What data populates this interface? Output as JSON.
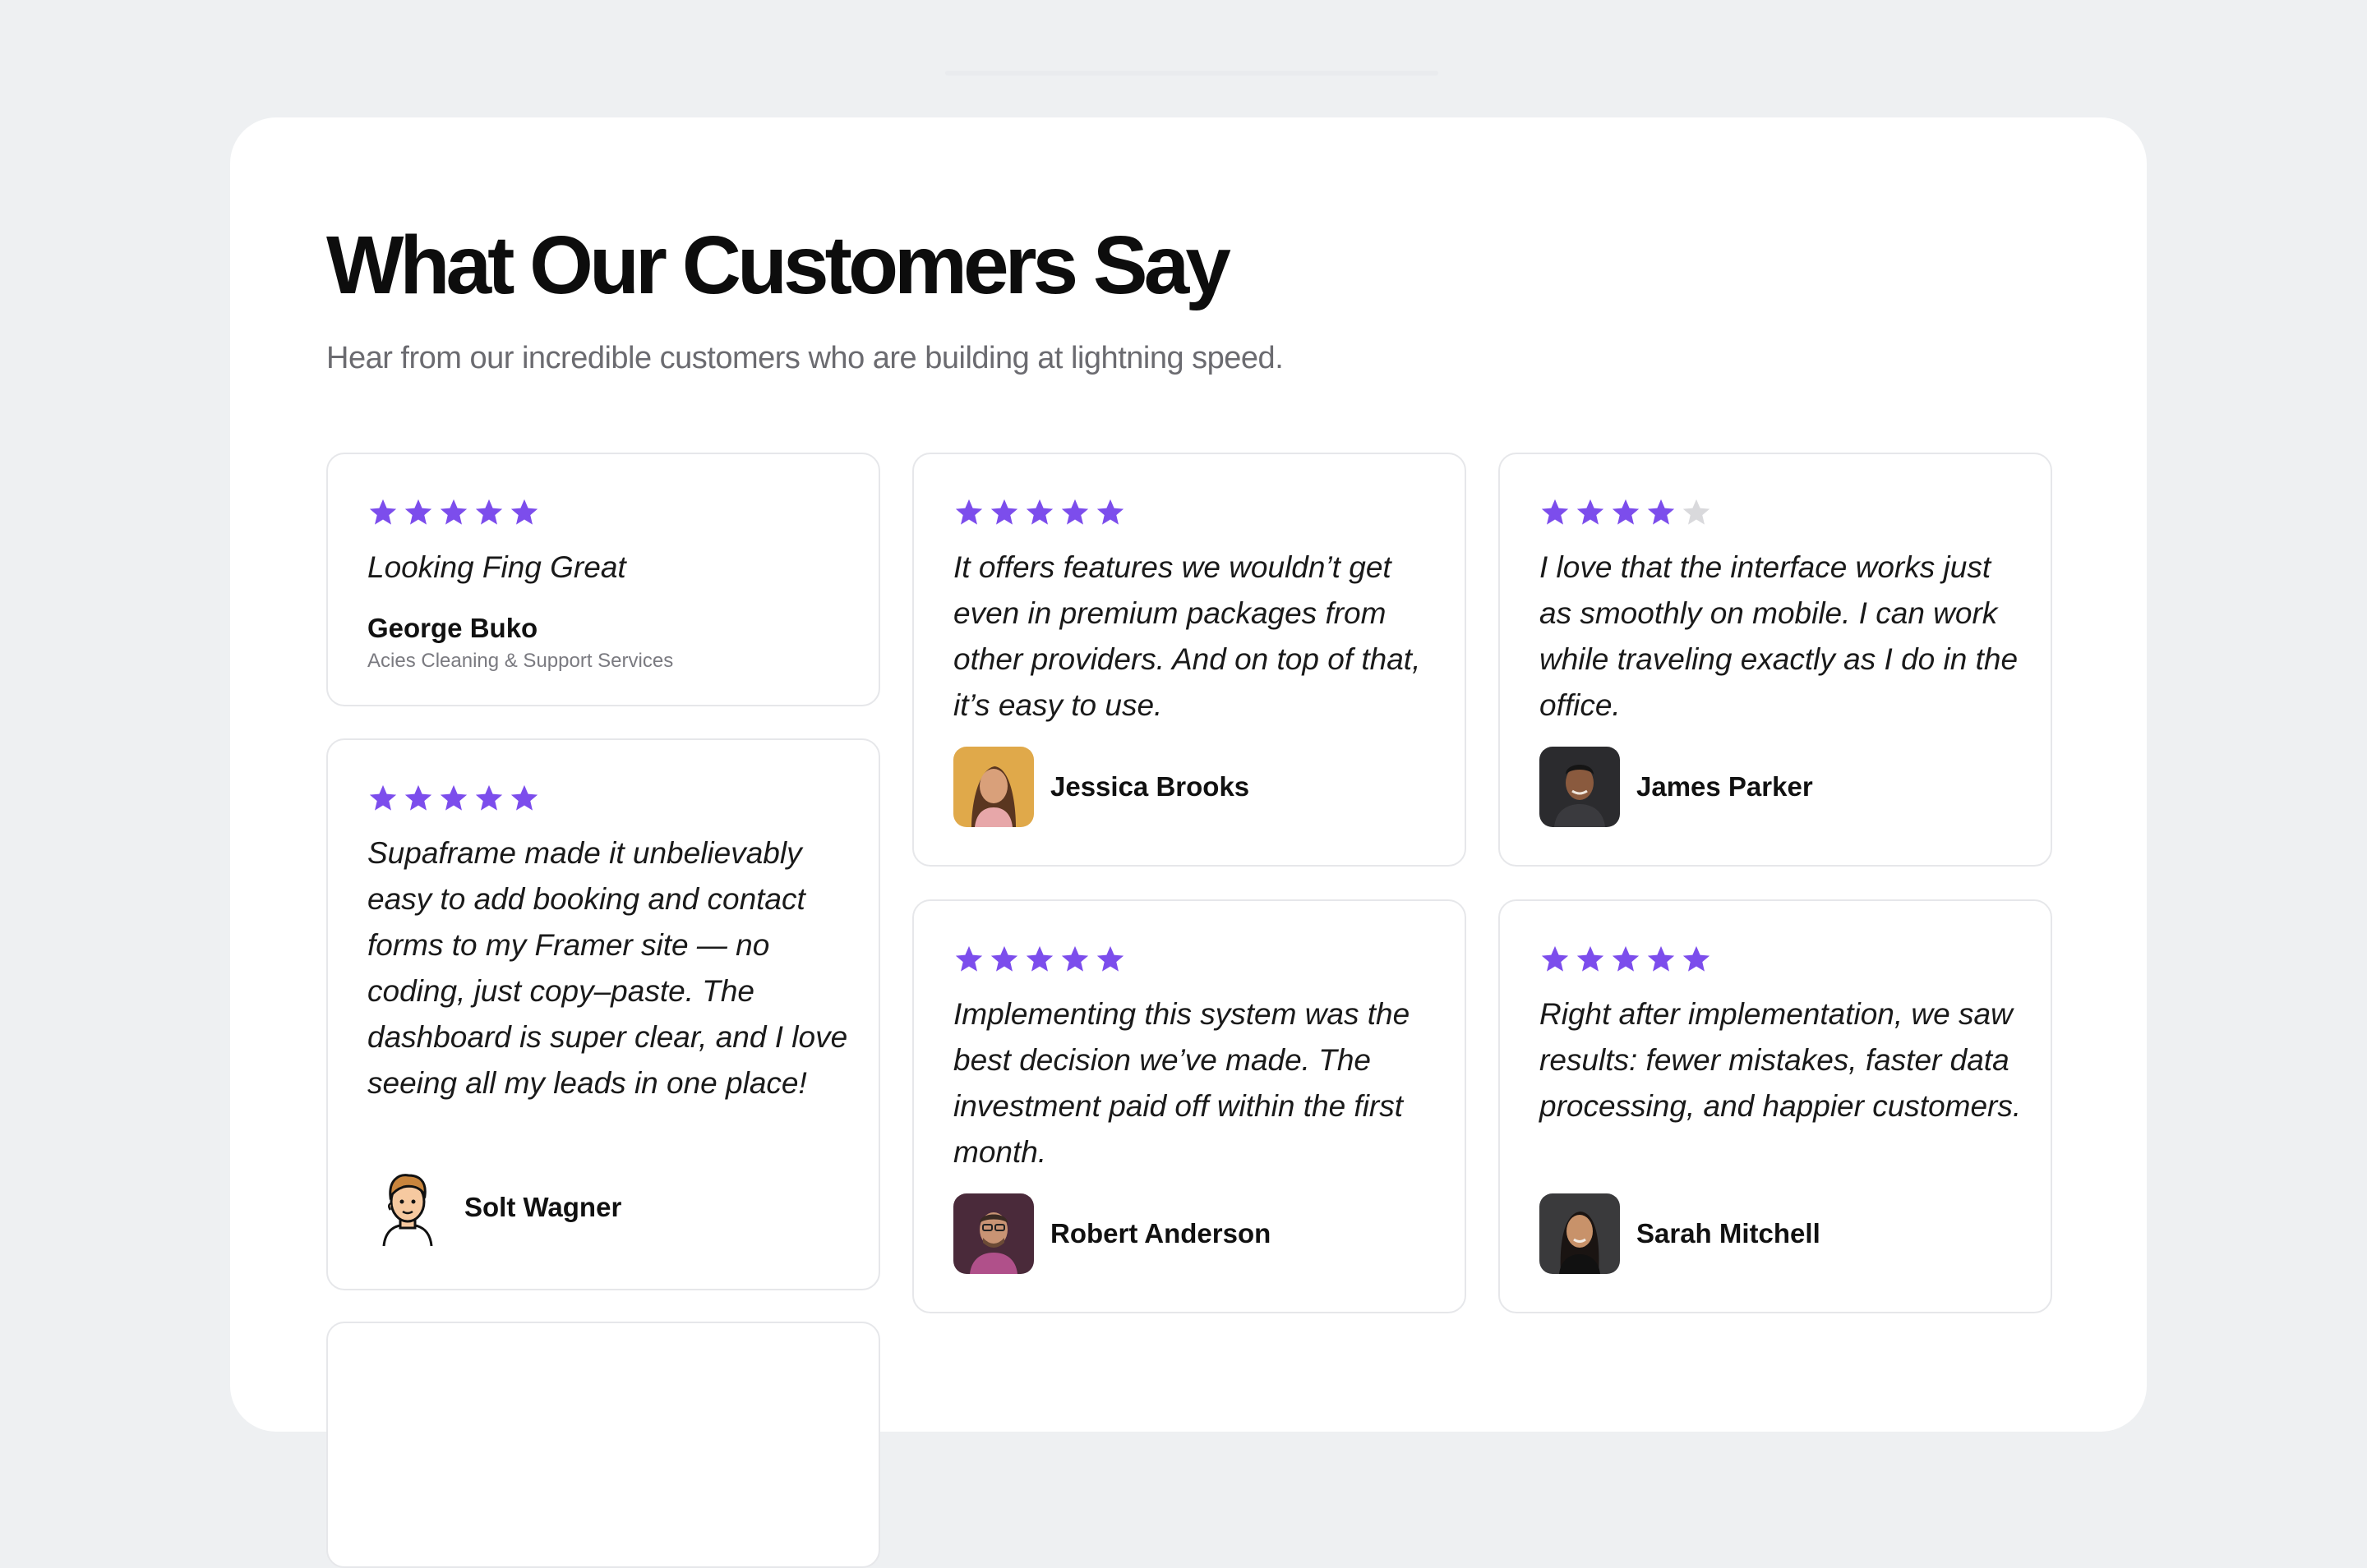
{
  "section": {
    "title": "What Our Customers Say",
    "subtitle": "Hear from our incredible customers who are building at lightning speed."
  },
  "colors": {
    "star_filled": "#7c4dec",
    "star_empty": "#d9d9dc"
  },
  "testimonials": [
    {
      "rating": 5,
      "quote": "Looking Fing Great",
      "name": "George Buko",
      "company": "Acies Cleaning & Support Services"
    },
    {
      "rating": 5,
      "quote": "Supaframe made it unbelievably easy to add booking and contact forms to my Framer site — no coding, just copy–paste. The dashboard is super clear, and I love seeing all my leads in one place!",
      "name": "Solt Wagner",
      "avatar": "cartoon-avatar"
    },
    {
      "rating": 5,
      "quote": "It offers features we wouldn’t get even in premium packages from other providers. And on top of that, it’s easy to use.",
      "name": "Jessica Brooks",
      "avatar": "photo-avatar"
    },
    {
      "rating": 5,
      "quote": "Implementing this system was the best decision we’ve made. The investment paid off within the first month.",
      "name": "Robert Anderson",
      "avatar": "photo-avatar"
    },
    {
      "rating": 4,
      "quote": "I love that the interface works just as smoothly on mobile. I can work while traveling exactly as I do in the office.",
      "name": "James Parker",
      "avatar": "photo-avatar"
    },
    {
      "rating": 5,
      "quote": "Right after implementation, we saw results: fewer mistakes, faster data processing, and happier customers.",
      "name": "Sarah Mitchell",
      "avatar": "photo-avatar"
    }
  ]
}
